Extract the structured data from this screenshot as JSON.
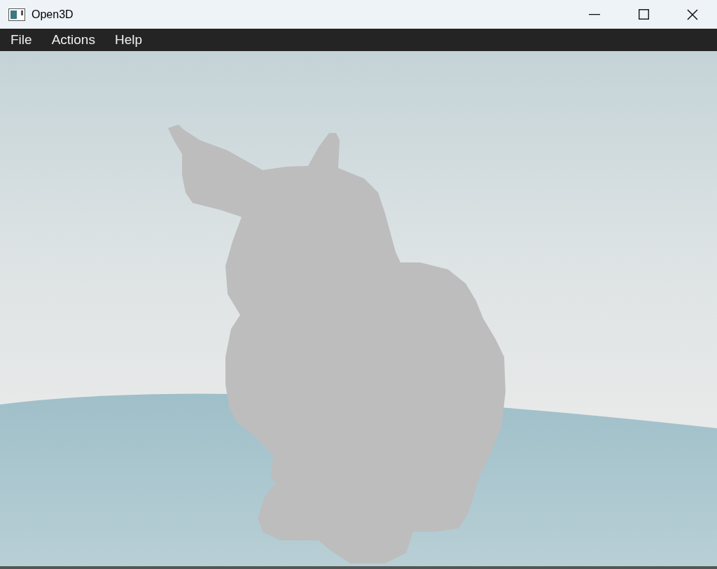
{
  "window": {
    "title": "Open3D"
  },
  "menu": [
    {
      "label": "File"
    },
    {
      "label": "Actions"
    },
    {
      "label": "Help"
    }
  ]
}
